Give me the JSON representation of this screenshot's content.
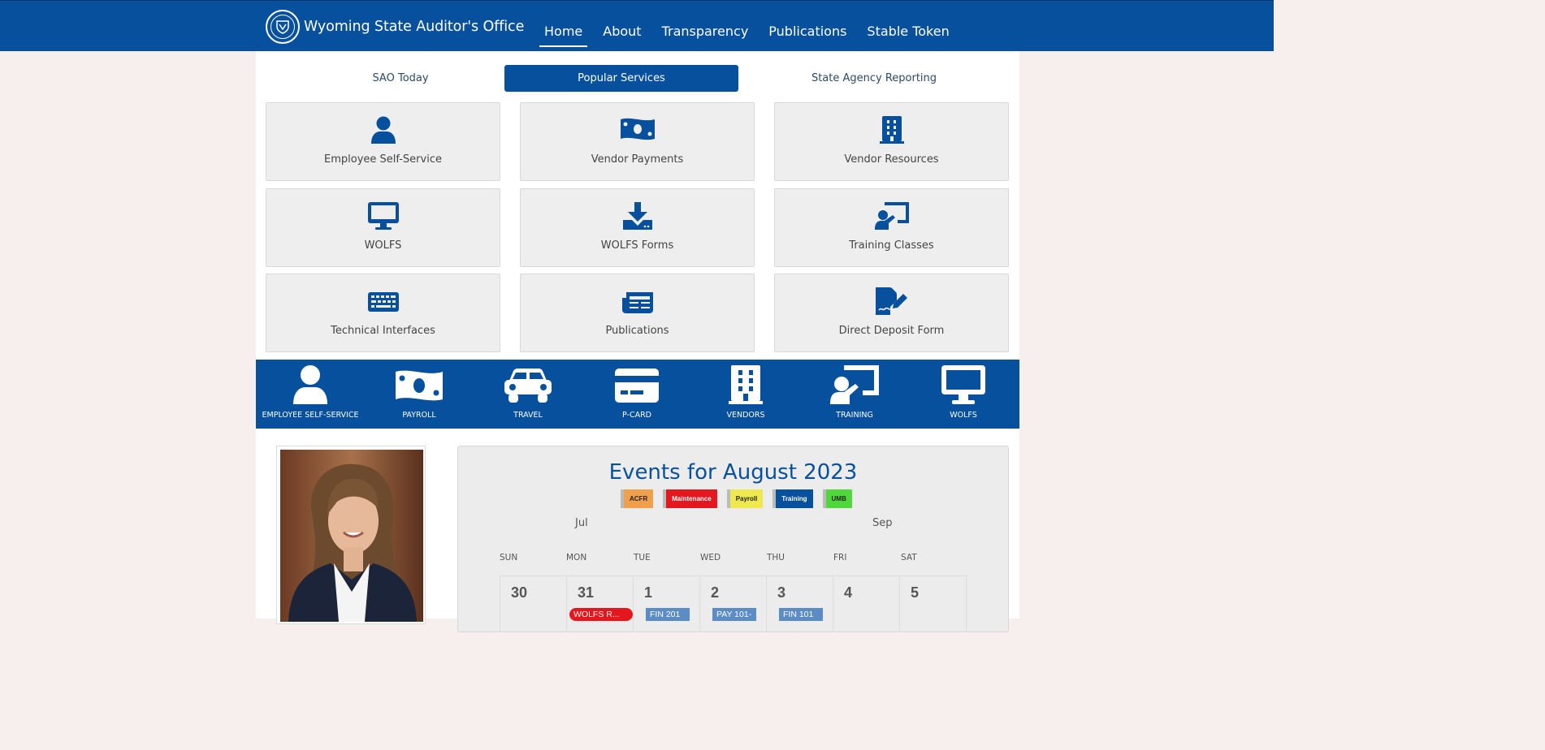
{
  "header": {
    "brand": "Wyoming State Auditor's Office",
    "nav": [
      "Home",
      "About",
      "Transparency",
      "Publications",
      "Stable Token"
    ]
  },
  "tabs": [
    "SAO Today",
    "Popular Services",
    "State Agency Reporting"
  ],
  "services": [
    {
      "label": "Employee Self-Service",
      "icon": "user-icon"
    },
    {
      "label": "Vendor Payments",
      "icon": "money-bill-icon"
    },
    {
      "label": "Vendor Resources",
      "icon": "building-icon"
    },
    {
      "label": "WOLFS",
      "icon": "desktop-icon"
    },
    {
      "label": "WOLFS Forms",
      "icon": "download-icon"
    },
    {
      "label": "Training Classes",
      "icon": "chalkboard-teacher-icon"
    },
    {
      "label": "Technical Interfaces",
      "icon": "keyboard-icon"
    },
    {
      "label": "Publications",
      "icon": "newspaper-icon"
    },
    {
      "label": "Direct Deposit Form",
      "icon": "file-signature-icon"
    }
  ],
  "quick_links": [
    {
      "label": "EMPLOYEE SELF-SERVICE",
      "icon": "user-icon"
    },
    {
      "label": "PAYROLL",
      "icon": "money-bill-icon"
    },
    {
      "label": "TRAVEL",
      "icon": "car-icon"
    },
    {
      "label": "P-CARD",
      "icon": "credit-card-icon"
    },
    {
      "label": "VENDORS",
      "icon": "building-icon"
    },
    {
      "label": "TRAINING",
      "icon": "chalkboard-teacher-icon"
    },
    {
      "label": "WOLFS",
      "icon": "desktop-icon"
    }
  ],
  "calendar": {
    "title": "Events for August 2023",
    "legend": [
      {
        "label": "ACFR",
        "color": "#f0a04b"
      },
      {
        "label": "Maintenance",
        "color": "#e3171d"
      },
      {
        "label": "Payroll",
        "color": "#efe84f"
      },
      {
        "label": "Training",
        "color": "#06509e"
      },
      {
        "label": "UMB",
        "color": "#4fd83a"
      }
    ],
    "prev_month": "Jul",
    "next_month": "Sep",
    "weekdays": [
      "SUN",
      "MON",
      "TUE",
      "WED",
      "THU",
      "FRI",
      "SAT"
    ],
    "days": [
      "30",
      "31",
      "1",
      "2",
      "3",
      "4",
      "5"
    ],
    "events": [
      {
        "label": "WOLFS R...",
        "color": "#e3171d"
      },
      {
        "label": "FIN 201",
        "color": "#5b8cc6"
      },
      {
        "label": "PAY 101-",
        "color": "#5b8cc6"
      },
      {
        "label": "FIN 101",
        "color": "#5b8cc6"
      }
    ]
  },
  "colors": {
    "brand": "#06509e",
    "card_bg": "#eeeeee"
  }
}
